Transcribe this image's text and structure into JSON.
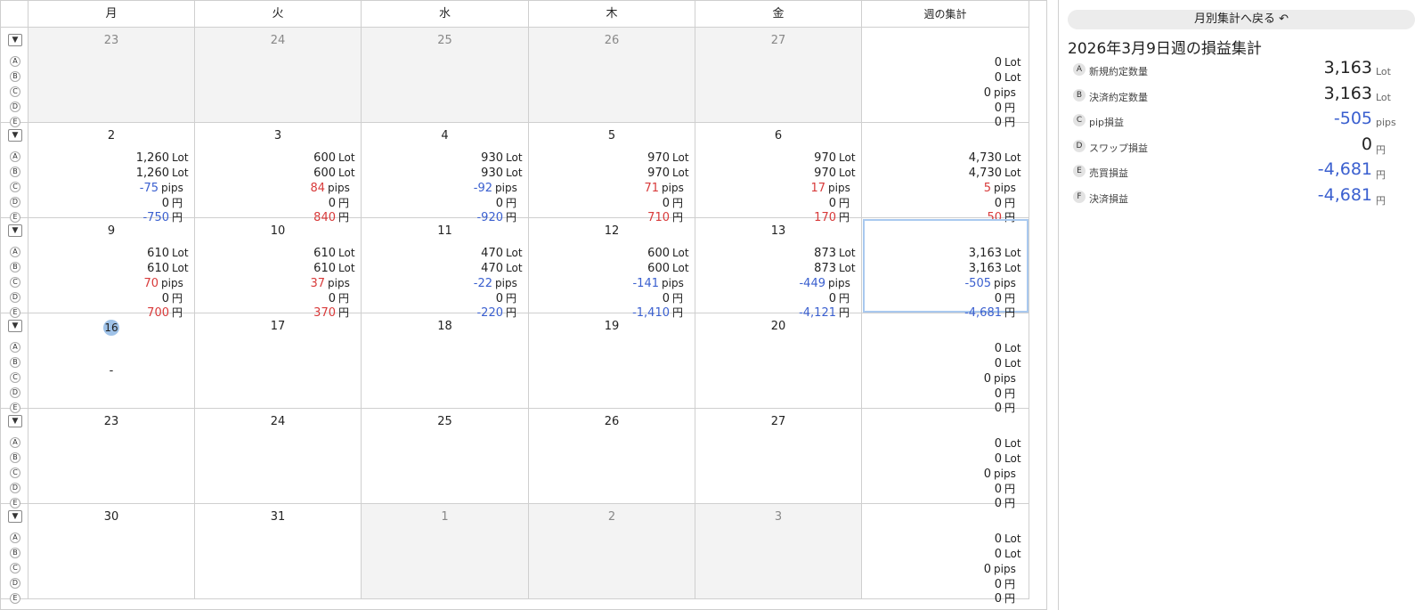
{
  "headers": [
    "月",
    "火",
    "水",
    "木",
    "金",
    "週の集計"
  ],
  "row_letters": [
    "A",
    "B",
    "C",
    "D",
    "E"
  ],
  "toggle_glyph": "▼",
  "units": [
    "Lot",
    "Lot",
    "pips",
    "円",
    "円"
  ],
  "weeks": [
    {
      "days": [
        {
          "day": "23",
          "outside": true,
          "vals": null
        },
        {
          "day": "24",
          "outside": true,
          "vals": null
        },
        {
          "day": "25",
          "outside": true,
          "vals": null
        },
        {
          "day": "26",
          "outside": true,
          "vals": null
        },
        {
          "day": "27",
          "outside": true,
          "vals": null
        }
      ],
      "summary": [
        "0",
        "0",
        "0",
        "0",
        "0"
      ]
    },
    {
      "days": [
        {
          "day": "2",
          "outside": false,
          "vals": [
            "1,260",
            "1,260",
            "-75",
            "0",
            "-750"
          ]
        },
        {
          "day": "3",
          "outside": false,
          "vals": [
            "600",
            "600",
            "84",
            "0",
            "840"
          ]
        },
        {
          "day": "4",
          "outside": false,
          "vals": [
            "930",
            "930",
            "-92",
            "0",
            "-920"
          ]
        },
        {
          "day": "5",
          "outside": false,
          "vals": [
            "970",
            "970",
            "71",
            "0",
            "710"
          ]
        },
        {
          "day": "6",
          "outside": false,
          "vals": [
            "970",
            "970",
            "17",
            "0",
            "170"
          ]
        }
      ],
      "summary": [
        "4,730",
        "4,730",
        "5",
        "0",
        "50"
      ]
    },
    {
      "days": [
        {
          "day": "9",
          "outside": false,
          "vals": [
            "610",
            "610",
            "70",
            "0",
            "700"
          ]
        },
        {
          "day": "10",
          "outside": false,
          "vals": [
            "610",
            "610",
            "37",
            "0",
            "370"
          ]
        },
        {
          "day": "11",
          "outside": false,
          "vals": [
            "470",
            "470",
            "-22",
            "0",
            "-220"
          ]
        },
        {
          "day": "12",
          "outside": false,
          "vals": [
            "600",
            "600",
            "-141",
            "0",
            "-1,410"
          ]
        },
        {
          "day": "13",
          "outside": false,
          "vals": [
            "873",
            "873",
            "-449",
            "0",
            "-4,121"
          ]
        }
      ],
      "summary": [
        "3,163",
        "3,163",
        "-505",
        "0",
        "-4,681"
      ],
      "selected": true
    },
    {
      "days": [
        {
          "day": "16",
          "outside": false,
          "vals": null,
          "today": true,
          "dash": "-"
        },
        {
          "day": "17",
          "outside": false,
          "vals": null
        },
        {
          "day": "18",
          "outside": false,
          "vals": null
        },
        {
          "day": "19",
          "outside": false,
          "vals": null
        },
        {
          "day": "20",
          "outside": false,
          "vals": null
        }
      ],
      "summary": [
        "0",
        "0",
        "0",
        "0",
        "0"
      ]
    },
    {
      "days": [
        {
          "day": "23",
          "outside": false,
          "vals": null
        },
        {
          "day": "24",
          "outside": false,
          "vals": null
        },
        {
          "day": "25",
          "outside": false,
          "vals": null
        },
        {
          "day": "26",
          "outside": false,
          "vals": null
        },
        {
          "day": "27",
          "outside": false,
          "vals": null
        }
      ],
      "summary": [
        "0",
        "0",
        "0",
        "0",
        "0"
      ]
    },
    {
      "days": [
        {
          "day": "30",
          "outside": false,
          "vals": null
        },
        {
          "day": "31",
          "outside": false,
          "vals": null
        },
        {
          "day": "1",
          "outside": true,
          "vals": null
        },
        {
          "day": "2",
          "outside": true,
          "vals": null
        },
        {
          "day": "3",
          "outside": true,
          "vals": null
        }
      ],
      "summary": [
        "0",
        "0",
        "0",
        "0",
        "0"
      ]
    }
  ],
  "panel": {
    "back_label": "月別集計へ戻る ↶",
    "title": "2026年3月9日週の損益集計",
    "rows": [
      {
        "letter": "A",
        "label": "新規約定数量",
        "value": "3,163",
        "unit": "Lot",
        "tone": ""
      },
      {
        "letter": "B",
        "label": "決済約定数量",
        "value": "3,163",
        "unit": "Lot",
        "tone": ""
      },
      {
        "letter": "C",
        "label": "pip損益",
        "value": "-505",
        "unit": "pips",
        "tone": "neg"
      },
      {
        "letter": "D",
        "label": "スワップ損益",
        "value": "0",
        "unit": "円",
        "tone": ""
      },
      {
        "letter": "E",
        "label": "売買損益",
        "value": "-4,681",
        "unit": "円",
        "tone": "neg"
      },
      {
        "letter": "F",
        "label": "決済損益",
        "value": "-4,681",
        "unit": "円",
        "tone": "neg"
      }
    ]
  },
  "colors": {
    "positive": "#d83a3a",
    "negative": "#3a5fcf",
    "today": "#9fc2e8",
    "outside_bg": "#f3f3f3"
  }
}
